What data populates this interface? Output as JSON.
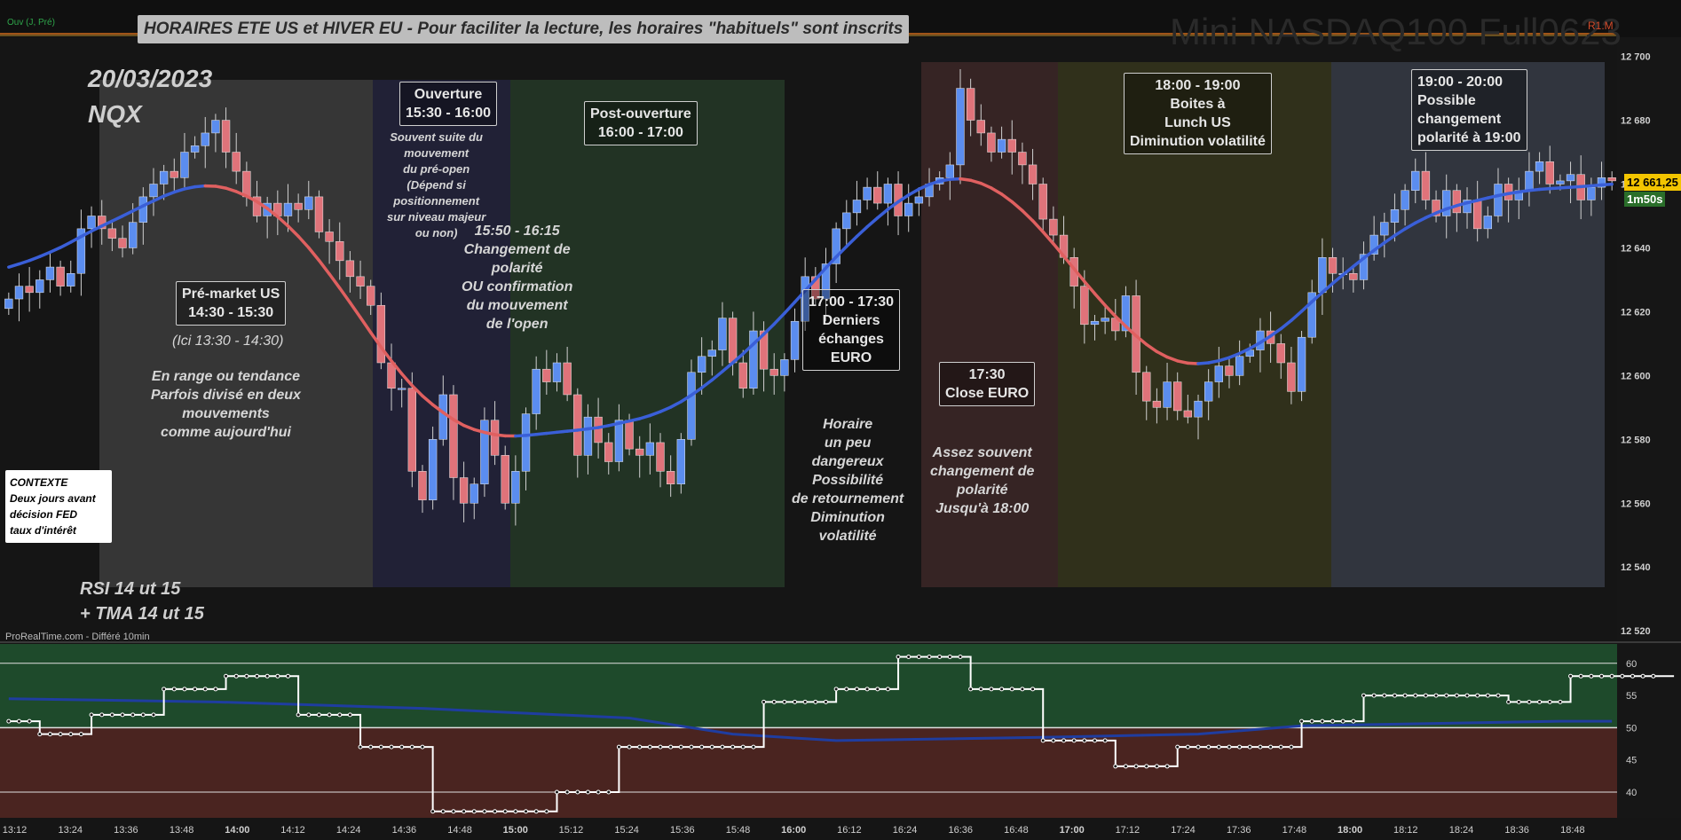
{
  "header": {
    "title_banner": "HORAIRES ETE US et HIVER EU - Pour faciliter la lecture, les horaires \"habituels\" sont inscrits",
    "watermark": "Mini NASDAQ100 Full0623",
    "date": "20/03/2023",
    "symbol": "NQX",
    "ovv_label": "Ouv (J, Pré)",
    "r1m": "R1.M",
    "source": "ProRealTime.com - Différé 10min",
    "indicators_note": "RSI 14 ut 15\n+ TMA 14 ut 15",
    "context": "CONTEXTE\nDeux jours avant\ndécision FED\ntaux d'intérêt",
    "last_price": "12 661,25",
    "timer": "1m50s"
  },
  "colors": {
    "background": "#151515",
    "bull_candle": "#5b8def",
    "bear_candle": "#e0737a",
    "tma_up": "#3a5fd8",
    "tma_down": "#e06060",
    "rsi_line": "#ffffff",
    "rsi_ma": "#1f3da0",
    "rsi_upper_zone": "#1e4a2b",
    "rsi_lower_zone": "#4a2420"
  },
  "sessions": [
    {
      "label_lines": [
        "Pré-market US",
        "14:30 - 15:30"
      ],
      "note": "(Ici 13:30 - 14:30)",
      "note2": "En range ou tendance\nParfois divisé en deux\nmouvements\ncomme aujourd'hui",
      "color": "#3a3a3a"
    },
    {
      "label_lines": [
        "Ouverture",
        "15:30 - 16:00"
      ],
      "note": "Souvent suite du\nmouvement\ndu pré-open\n(Dépend si\npositionnement\nsur niveau majeur\nou non)",
      "note2": "15:50 - 16:15\nChangement de\npolarité\nOU confirmation\ndu mouvement\nde l'open",
      "color": "#22223a"
    },
    {
      "label_lines": [
        "Post-ouverture",
        "16:00 - 17:00"
      ],
      "note": "",
      "note2": "",
      "color": "#233626"
    },
    {
      "label_lines": [
        "17:00 - 17:30",
        "Derniers",
        "échanges",
        "EURO"
      ],
      "note": "",
      "note2": "Horaire\nun peu\ndangereux\nPossibilité\nde retournement\nDiminution\nvolatilité",
      "color": "#151515"
    },
    {
      "label_lines": [
        "17:30",
        "Close EURO"
      ],
      "note": "",
      "note2": "Assez souvent\nchangement de\npolarité\nJusqu'à 18:00",
      "color": "#3a2626"
    },
    {
      "label_lines": [
        "18:00 - 19:00",
        "Boites à",
        "Lunch US",
        "Diminution volatilité"
      ],
      "note": "",
      "note2": "",
      "color": "#33331c"
    },
    {
      "label_lines": [
        "19:00 - 20:00",
        "Possible",
        "changement",
        "polarité à 19:00"
      ],
      "note": "",
      "note2": "",
      "color": "#343842"
    }
  ],
  "chart_data": [
    {
      "type": "candlestick",
      "title": "Mini NASDAQ100 Full0623",
      "y_axis_ticks": [
        12520,
        12540,
        12560,
        12580,
        12600,
        12620,
        12640,
        12660,
        12680,
        12700
      ],
      "y_axis_tick_labels": [
        "12 520",
        "12 540",
        "12 560",
        "12 580",
        "12 600",
        "12 620",
        "12 640",
        "12 660",
        "12 680",
        "12 700"
      ],
      "ylim": [
        12517,
        12706
      ],
      "x_axis_labels": [
        "13:12",
        "13:24",
        "13:36",
        "13:48",
        "14:00",
        "14:12",
        "14:24",
        "14:36",
        "14:48",
        "15:00",
        "15:12",
        "15:24",
        "15:36",
        "15:48",
        "16:00",
        "16:12",
        "16:24",
        "16:36",
        "16:48",
        "17:00",
        "17:12",
        "17:24",
        "17:36",
        "17:48",
        "18:00",
        "18:12",
        "18:24",
        "18:36",
        "18:48"
      ],
      "x_axis_bold": [
        "14:00",
        "15:00",
        "16:00",
        "17:00",
        "18:00"
      ],
      "close_series": [
        12624,
        12628,
        12626,
        12630,
        12634,
        12628,
        12632,
        12646,
        12650,
        12646,
        12643,
        12640,
        12648,
        12656,
        12660,
        12664,
        12662,
        12670,
        12672,
        12676,
        12680,
        12670,
        12664,
        12656,
        12650,
        12654,
        12650,
        12654,
        12652,
        12656,
        12645,
        12642,
        12636,
        12631,
        12628,
        12622,
        12604,
        12596,
        12596,
        12570,
        12561,
        12580,
        12594,
        12568,
        12560,
        12566,
        12586,
        12575,
        12560,
        12570,
        12588,
        12602,
        12598,
        12604,
        12594,
        12575,
        12587,
        12579,
        12573,
        12586,
        12577,
        12575,
        12579,
        12570,
        12566,
        12580,
        12601,
        12606,
        12608,
        12618,
        12604,
        12596,
        12614,
        12602,
        12600,
        12605,
        12617,
        12631,
        12624,
        12635,
        12646,
        12651,
        12655,
        12659,
        12654,
        12660,
        12650,
        12654,
        12656,
        12660,
        12662,
        12666,
        12690,
        12680,
        12676,
        12670,
        12674,
        12670,
        12666,
        12660,
        12649,
        12644,
        12637,
        12628,
        12616,
        12617,
        12618,
        12614,
        12625,
        12601,
        12592,
        12590,
        12598,
        12589,
        12587,
        12592,
        12598,
        12603,
        12600,
        12606,
        12608,
        12614,
        12610,
        12604,
        12595,
        12612,
        12626,
        12637,
        12632,
        12632,
        12630,
        12638,
        12644,
        12648,
        12652,
        12658,
        12664,
        12655,
        12650,
        12658,
        12651,
        12655,
        12646,
        12650,
        12660,
        12655,
        12658,
        12664,
        12667,
        12660,
        12661,
        12663,
        12655,
        12659,
        12662,
        12661
      ],
      "ma_label": "TMA 14 ut 15"
    },
    {
      "type": "line",
      "title": "RSI 14 ut 15",
      "y_axis_ticks": [
        40,
        45,
        50,
        55,
        60
      ],
      "ylim": [
        36,
        63
      ],
      "hlines": [
        40,
        50,
        60
      ],
      "rsi_steps": [
        [
          0,
          51
        ],
        [
          3,
          49
        ],
        [
          8,
          52
        ],
        [
          15,
          56
        ],
        [
          21,
          58
        ],
        [
          28,
          52
        ],
        [
          34,
          47
        ],
        [
          41,
          37
        ],
        [
          53,
          40
        ],
        [
          59,
          47
        ],
        [
          66,
          47
        ],
        [
          73,
          54
        ],
        [
          80,
          56
        ],
        [
          86,
          61
        ],
        [
          93,
          56
        ],
        [
          100,
          48
        ],
        [
          107,
          44
        ],
        [
          113,
          47
        ],
        [
          125,
          51
        ],
        [
          131,
          55
        ],
        [
          137,
          55
        ],
        [
          145,
          54
        ],
        [
          151,
          58
        ],
        [
          160,
          58
        ]
      ],
      "rsi_ma": [
        [
          0,
          54.5
        ],
        [
          20,
          54
        ],
        [
          40,
          53
        ],
        [
          60,
          51.5
        ],
        [
          70,
          49
        ],
        [
          80,
          48
        ],
        [
          100,
          48.5
        ],
        [
          115,
          49
        ],
        [
          125,
          50.3
        ],
        [
          150,
          51
        ],
        [
          155,
          51
        ]
      ]
    }
  ]
}
